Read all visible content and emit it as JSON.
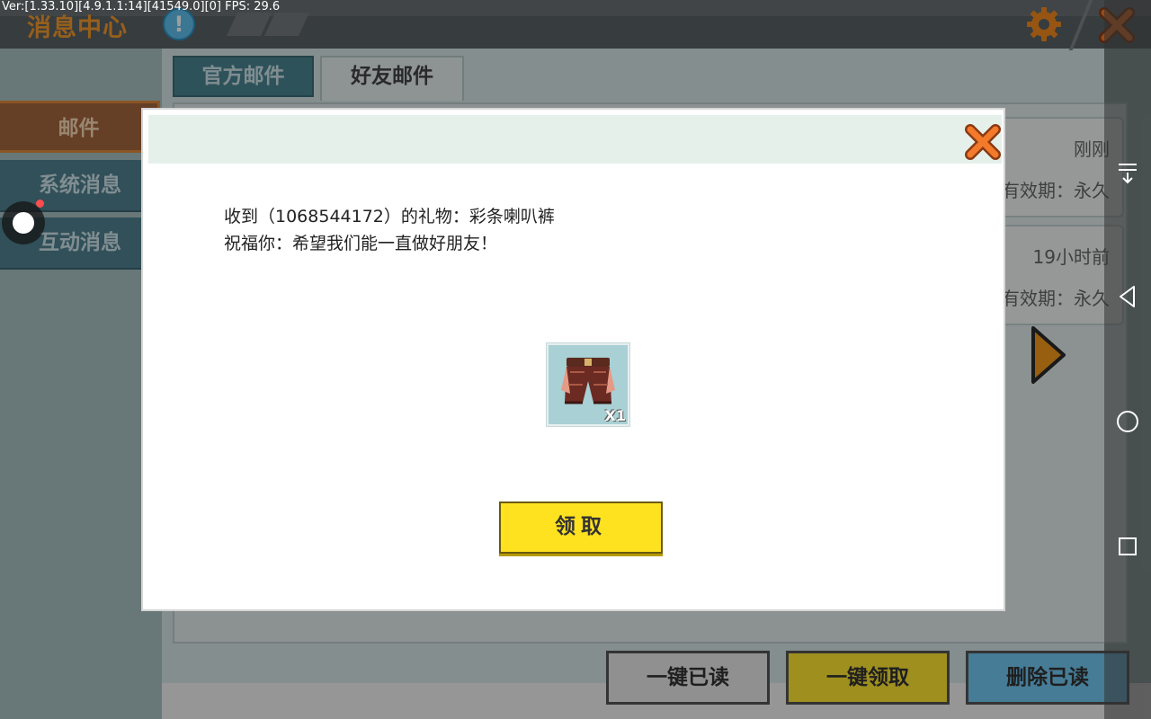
{
  "debug": {
    "text": "Ver:[1.33.10][4.9.1.1:14][41549.0][0] FPS: 29.6"
  },
  "header": {
    "title": "消息中心",
    "notice_glyph": "!"
  },
  "sidebar": {
    "items": [
      {
        "label": "邮件",
        "active": true
      },
      {
        "label": "系统消息",
        "active": false
      },
      {
        "label": "互动消息",
        "active": false
      }
    ]
  },
  "tabs": [
    {
      "label": "官方邮件",
      "active": false
    },
    {
      "label": "好友邮件",
      "active": true
    }
  ],
  "mail_list": [
    {
      "time": "刚刚",
      "validity": "有效期：永久"
    },
    {
      "time": "19小时前",
      "validity": "有效期：永久"
    }
  ],
  "bottom_buttons": {
    "mark_read": "一键已读",
    "claim_all": "一键领取",
    "delete_read": "删除已读"
  },
  "modal": {
    "line1": "收到（1068544172）的礼物：彩条喇叭裤",
    "line2": "祝福你：希望我们能一直做好朋友！",
    "item": {
      "name": "彩条喇叭裤",
      "icon": "shorts-icon",
      "quantity": "X1"
    },
    "claim_label": "领取"
  },
  "colors": {
    "accent_orange": "#f29a2e",
    "claim_yellow": "#ffe21f",
    "tab_teal": "#4b8591",
    "delete_blue": "#72c8f3"
  }
}
